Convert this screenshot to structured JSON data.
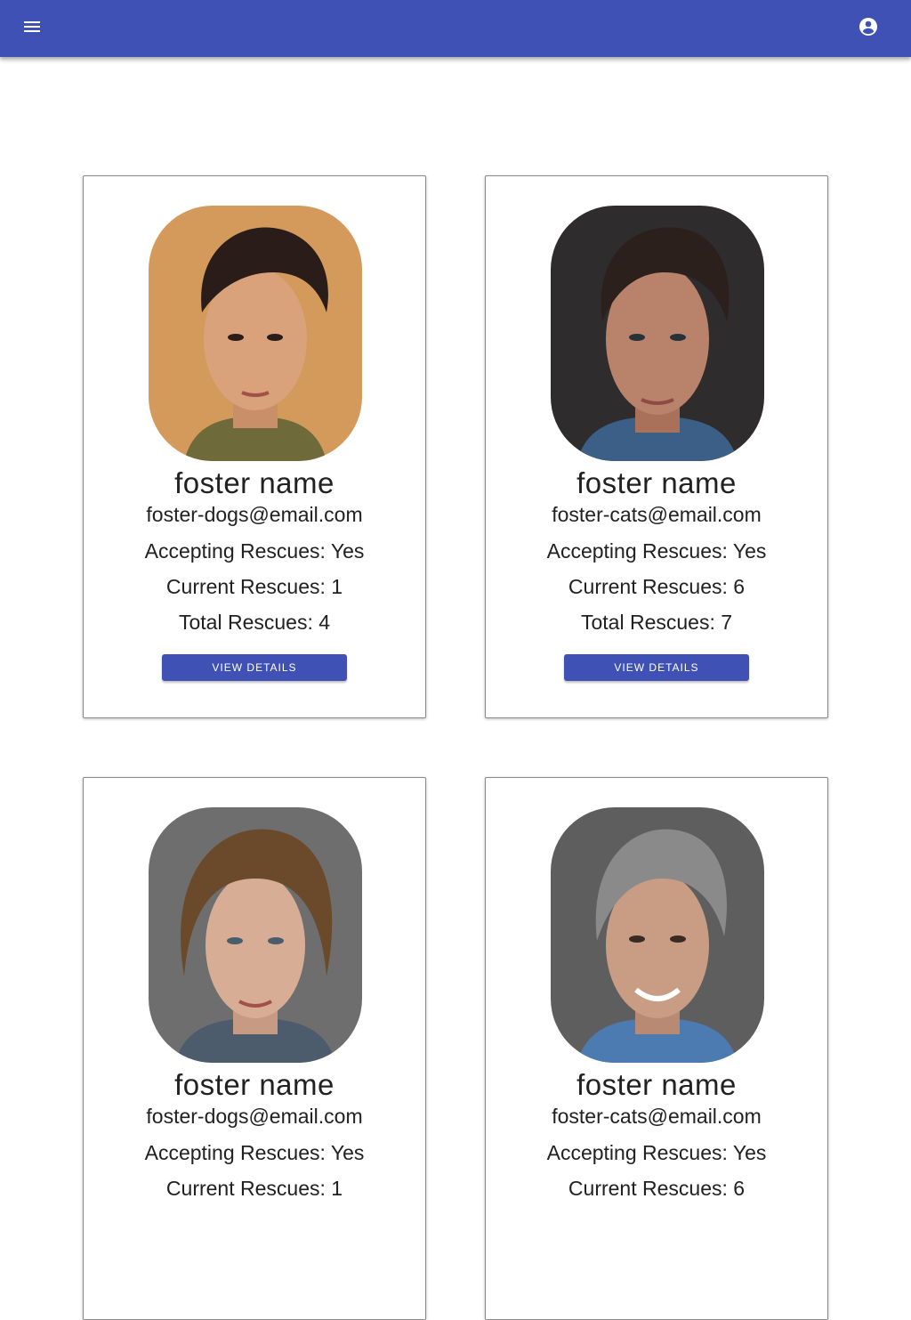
{
  "appbar": {
    "menu_icon": "menu-icon",
    "account_icon": "account-circle-icon",
    "color": "#3f51b5"
  },
  "fosters": [
    {
      "name": "foster name",
      "email": "foster-dogs@email.com",
      "accepting": "Accepting Rescues: Yes",
      "current": "Current Rescues: 1",
      "total": "Total Rescues: 4",
      "button": "View Details"
    },
    {
      "name": "foster name",
      "email": "foster-cats@email.com",
      "accepting": "Accepting Rescues: Yes",
      "current": "Current Rescues: 6",
      "total": "Total Rescues: 7",
      "button": "View Details"
    },
    {
      "name": "foster name",
      "email": "foster-dogs@email.com",
      "accepting": "Accepting Rescues: Yes",
      "current": "Current Rescues: 1"
    },
    {
      "name": "foster name",
      "email": "foster-cats@email.com",
      "accepting": "Accepting Rescues: Yes",
      "current": "Current Rescues: 6"
    }
  ]
}
